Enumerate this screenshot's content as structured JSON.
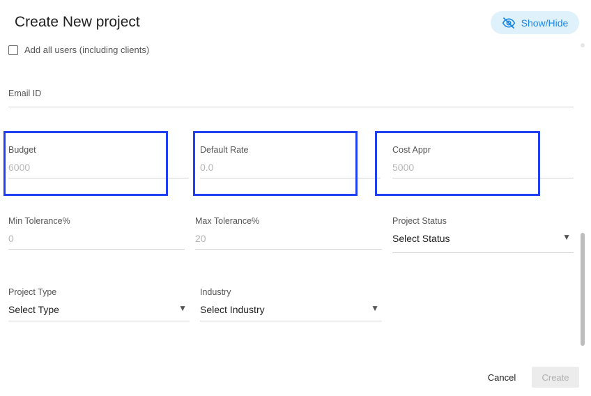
{
  "dialog": {
    "title": "Create New project",
    "show_hide_label": "Show/Hide",
    "add_all_users_label": "Add all users (including clients)"
  },
  "fields": {
    "email": {
      "label": "Email ID",
      "value": ""
    },
    "budget": {
      "label": "Budget",
      "value": "6000"
    },
    "default_rate": {
      "label": "Default Rate",
      "value": "0.0"
    },
    "cost_appr": {
      "label": "Cost Appr",
      "value": "5000"
    },
    "min_tolerance": {
      "label": "Min Tolerance%",
      "value": "0"
    },
    "max_tolerance": {
      "label": "Max Tolerance%",
      "value": "20"
    },
    "project_status": {
      "label": "Project Status",
      "value": "Select Status"
    },
    "project_type": {
      "label": "Project Type",
      "value": "Select Type"
    },
    "industry": {
      "label": "Industry",
      "value": "Select Industry"
    }
  },
  "actions": {
    "cancel_label": "Cancel",
    "create_label": "Create"
  },
  "icons": {
    "show_hide": "eye-off-icon",
    "dropdown": "triangle-down-icon",
    "checkbox": "checkbox-unchecked-icon"
  },
  "colors": {
    "accent": "#1e88e5",
    "highlight_box": "#1f3ff0",
    "chip_bg": "#dff1fb"
  }
}
